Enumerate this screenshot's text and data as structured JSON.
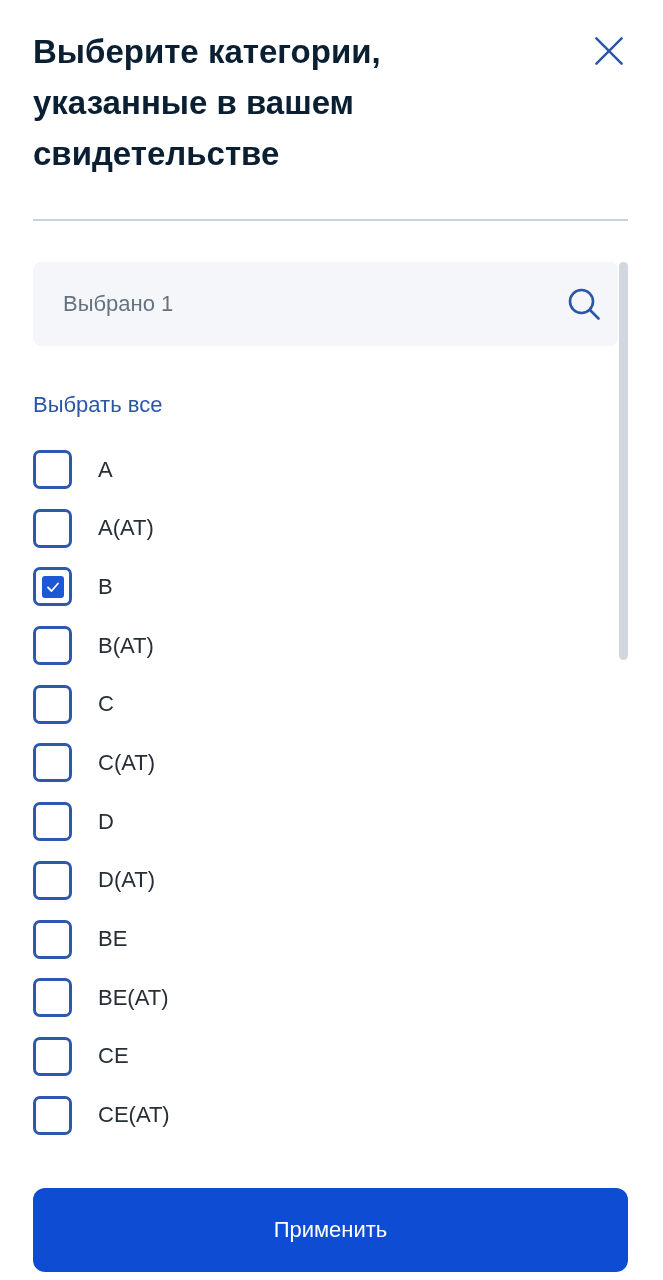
{
  "header": {
    "title": "Выберите категории, указанные в вашем свидетельстве"
  },
  "search": {
    "placeholder": "Выбрано 1"
  },
  "select_all": {
    "label": "Выбрать все"
  },
  "categories": [
    {
      "label": "A",
      "checked": false
    },
    {
      "label": "A(AT)",
      "checked": false
    },
    {
      "label": "B",
      "checked": true
    },
    {
      "label": "B(AT)",
      "checked": false
    },
    {
      "label": "C",
      "checked": false
    },
    {
      "label": "C(AT)",
      "checked": false
    },
    {
      "label": "D",
      "checked": false
    },
    {
      "label": "D(AT)",
      "checked": false
    },
    {
      "label": "BE",
      "checked": false
    },
    {
      "label": "BE(AT)",
      "checked": false
    },
    {
      "label": "CE",
      "checked": false
    },
    {
      "label": "CE(AT)",
      "checked": false
    }
  ],
  "apply_button": {
    "label": "Применить"
  }
}
